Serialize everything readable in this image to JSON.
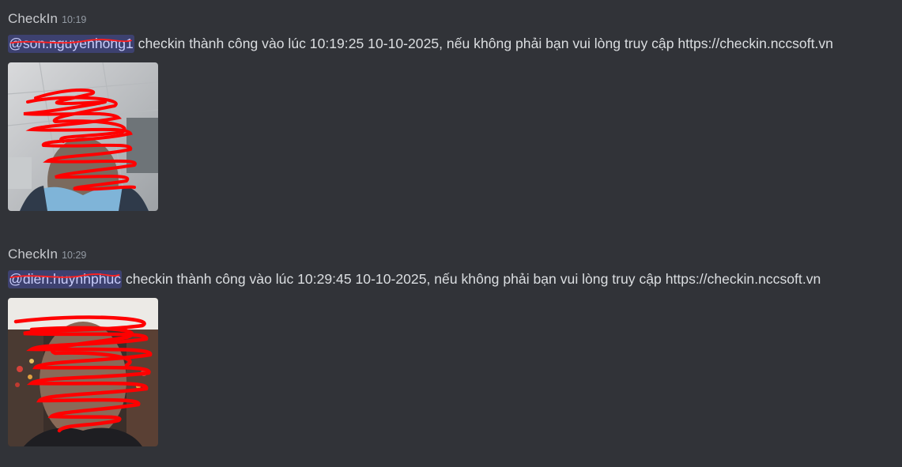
{
  "messages": [
    {
      "author": "CheckIn",
      "time": "10:19",
      "mention": "@son.nguyenhong1",
      "text": " checkin thành công vào lúc 10:19:25 10-10-2025, nếu không phải bạn vui lòng truy cập https://checkin.nccsoft.vn"
    },
    {
      "author": "CheckIn",
      "time": "10:29",
      "mention": "@dien.huynhphuc",
      "text": " checkin thành công vào lúc 10:29:45 10-10-2025, nếu không phải bạn vui lòng truy cập https://checkin.nccsoft.vn"
    }
  ],
  "colors": {
    "background": "#313338",
    "author": "#c7c9cd",
    "timestamp": "#949ba4",
    "text": "#dbdee1",
    "mention_bg": "#3c4270",
    "mention_text": "#c9cdfb",
    "redaction": "#ff0000"
  }
}
